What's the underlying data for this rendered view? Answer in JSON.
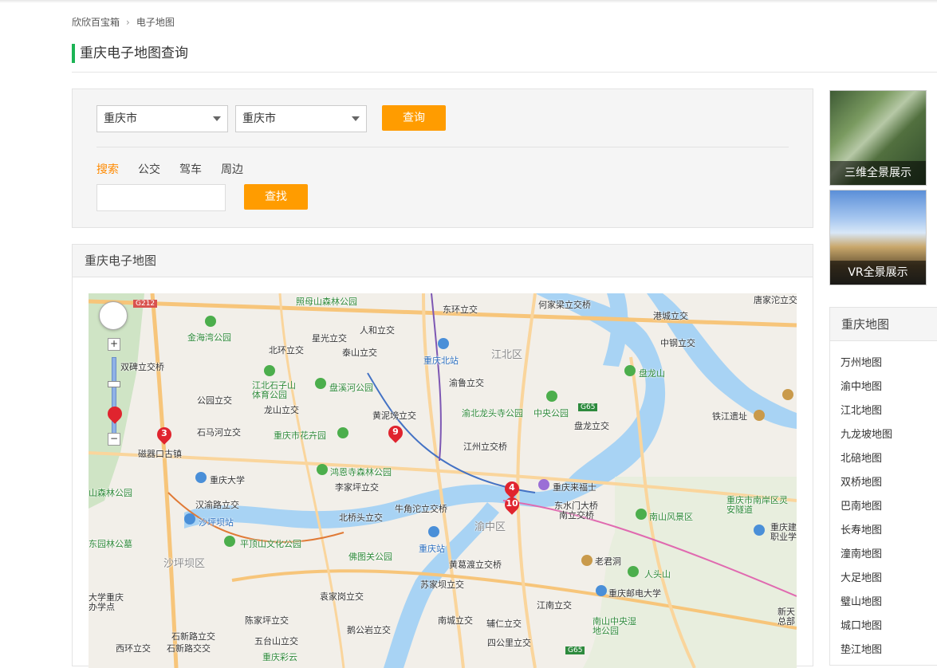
{
  "breadcrumb": {
    "home": "欣欣百宝箱",
    "current": "电子地图"
  },
  "page_title": "重庆电子地图查询",
  "query": {
    "province_select": "重庆市",
    "city_select": "重庆市",
    "query_button": "查询",
    "tabs": [
      {
        "label": "搜索",
        "active": true
      },
      {
        "label": "公交",
        "active": false
      },
      {
        "label": "驾车",
        "active": false
      },
      {
        "label": "周边",
        "active": false
      }
    ],
    "search_input_value": "",
    "find_button": "查找"
  },
  "map_panel": {
    "title": "重庆电子地图",
    "labels": {
      "l1": "照母山森林公园",
      "l2": "东环立交",
      "l3": "何家梁立交桥",
      "l4": "唐家沱立交",
      "l5": "人和立交",
      "l6": "星光立交",
      "l7": "北环立交",
      "l8": "泰山立交",
      "l9": "金海湾公园",
      "l10": "重庆北站",
      "l11": "江北区",
      "l12": "港城立交",
      "l13": "中钢立交",
      "l14": "双碑立交桥",
      "l15": "渝鲁立交",
      "l16": "盘龙山",
      "l17": "江北石子山体育公园",
      "l18": "盘溪河公园",
      "l19": "公园立交",
      "l20": "龙山立交",
      "l21": "黄泥塝立交",
      "l22": "渝北龙头寺公园",
      "l23": "中央公园",
      "l24": "铁江遗址",
      "l25": "石马河立交",
      "l26": "重庆市花卉园",
      "l27": "盘龙立交",
      "l28": "磁器口古镇",
      "l29": "江州立交桥",
      "l30": "重庆大学",
      "l31": "鸿恩寺森林公园",
      "l32": "李家坪立交",
      "l33": "重庆来福士",
      "l34": "重庆市南岸区灵安隧道",
      "l35": "汉渝路立交",
      "l36": "牛角沱立交桥",
      "l37": "东水门大桥",
      "l38": "沙坪坝站",
      "l39": "北桥头立交",
      "l40": "南立交桥",
      "l41": "渝中区",
      "l42": "南山风景区",
      "l43": "重庆建职业学",
      "l44": "东园林公墓",
      "l45": "平顶山文化公园",
      "l46": "佛图关公园",
      "l47": "重庆站",
      "l48": "老君洞",
      "l49": "沙坪坝区",
      "l50": "黄葛渡立交桥",
      "l51": "人头山",
      "l52": "苏家坝立交",
      "l53": "重庆邮电大学",
      "l54": "大学重庆办学点",
      "l55": "袁家岗立交",
      "l56": "江南立交",
      "l57": "陈家坪立交",
      "l58": "南城立交",
      "l59": "辅仁立交",
      "l60": "南山中央湿地公园",
      "l61": "新天总部",
      "l62": "鹅公岩立交",
      "l63": "西环立交",
      "l64": "石新路立交",
      "l65": "石新路交交",
      "l66": "五台山立交",
      "l67": "四公里立交",
      "l68": "重庆彩云",
      "l69": "山森林公园"
    },
    "road_shields": {
      "g212": "G212",
      "g65a": "G65",
      "g65b": "G65"
    },
    "pins": [
      "3",
      "9",
      "4",
      "10"
    ]
  },
  "side_links": {
    "panorama_3d": "三维全景展示",
    "panorama_vr": "VR全景展示"
  },
  "district_box": {
    "title": "重庆地图",
    "items": [
      "万州地图",
      "渝中地图",
      "江北地图",
      "九龙坡地图",
      "北碚地图",
      "双桥地图",
      "巴南地图",
      "长寿地图",
      "潼南地图",
      "大足地图",
      "璧山地图",
      "城口地图",
      "垫江地图"
    ]
  },
  "colors": {
    "accent": "#ff9c00",
    "title_bar": "#1cb455",
    "tab_active": "#ff8a00",
    "pin": "#e0242e",
    "river": "#a8d3f4"
  }
}
